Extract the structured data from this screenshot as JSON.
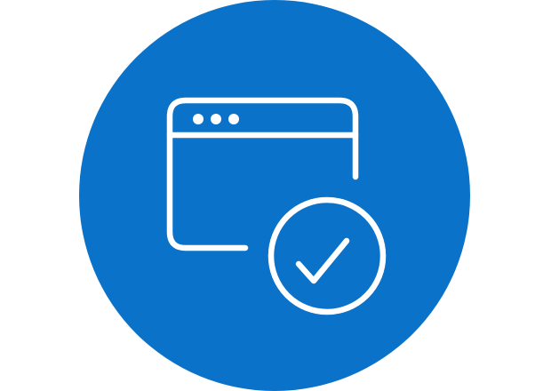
{
  "icon": {
    "name": "browser-window-check-icon",
    "background_color": "#0A72C9",
    "line_color": "#FFFFFF"
  }
}
